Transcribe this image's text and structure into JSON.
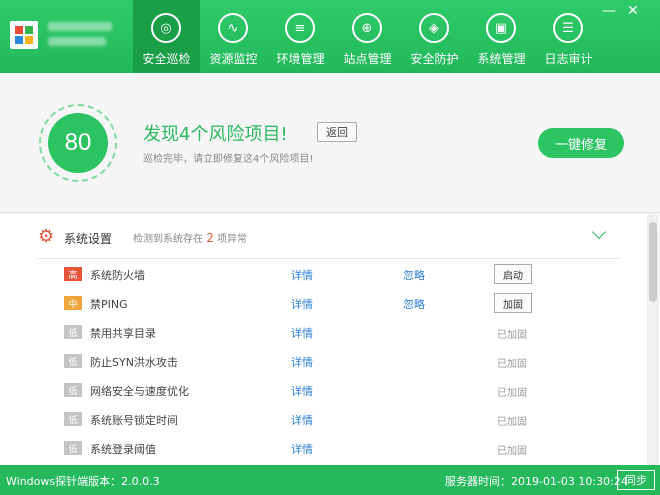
{
  "window": {
    "minimize_glyph": "—",
    "close_glyph": "✕"
  },
  "nav": {
    "items": [
      {
        "label": "安全巡检",
        "icon": "scan-icon",
        "glyph": "◎"
      },
      {
        "label": "资源监控",
        "icon": "monitor-icon",
        "glyph": "∿"
      },
      {
        "label": "环境管理",
        "icon": "server-icon",
        "glyph": "≡"
      },
      {
        "label": "站点管理",
        "icon": "globe-icon",
        "glyph": "⊕"
      },
      {
        "label": "安全防护",
        "icon": "shield-icon",
        "glyph": "◈"
      },
      {
        "label": "系统管理",
        "icon": "settings-icon",
        "glyph": "▣"
      },
      {
        "label": "日志审计",
        "icon": "document-icon",
        "glyph": "☰"
      }
    ],
    "active_index": 0
  },
  "result": {
    "score": "80",
    "title": "发现4个风险项目!",
    "back_label": "返回",
    "subtitle": "巡检完毕，请立即修复这4个风险项目!",
    "fix_label": "一键修复"
  },
  "section": {
    "title": "系统设置",
    "desc_prefix": "检测到系统存在",
    "count": "2",
    "desc_suffix": "项异常",
    "gear_glyph": "⚙"
  },
  "rows": [
    {
      "level": "高",
      "level_class": "high",
      "name": "系统防火墙",
      "detail": "详情",
      "ignore": "忽略",
      "action": "启动",
      "status": ""
    },
    {
      "level": "中",
      "level_class": "mid",
      "name": "禁PING",
      "detail": "详情",
      "ignore": "忽略",
      "action": "加固",
      "status": ""
    },
    {
      "level": "低",
      "level_class": "low",
      "name": "禁用共享目录",
      "detail": "详情",
      "ignore": "",
      "action": "",
      "status": "已加固"
    },
    {
      "level": "低",
      "level_class": "low",
      "name": "防止SYN洪水攻击",
      "detail": "详情",
      "ignore": "",
      "action": "",
      "status": "已加固"
    },
    {
      "level": "低",
      "level_class": "low",
      "name": "网络安全与速度优化",
      "detail": "详情",
      "ignore": "",
      "action": "",
      "status": "已加固"
    },
    {
      "level": "低",
      "level_class": "low",
      "name": "系统账号锁定时间",
      "detail": "详情",
      "ignore": "",
      "action": "",
      "status": "已加固"
    },
    {
      "level": "低",
      "level_class": "low",
      "name": "系统登录阈值",
      "detail": "详情",
      "ignore": "",
      "action": "",
      "status": "已加固"
    }
  ],
  "footer": {
    "version": "Windows探针端版本：2.0.0.3",
    "server_time": "服务器时间：2019-01-03 10:30:24",
    "sync_label": "同步"
  },
  "colors": {
    "brand": "#2cc463",
    "high": "#e6543a",
    "mid": "#f0a63a",
    "low": "#c4c4c4",
    "link": "#2c7fd8"
  }
}
